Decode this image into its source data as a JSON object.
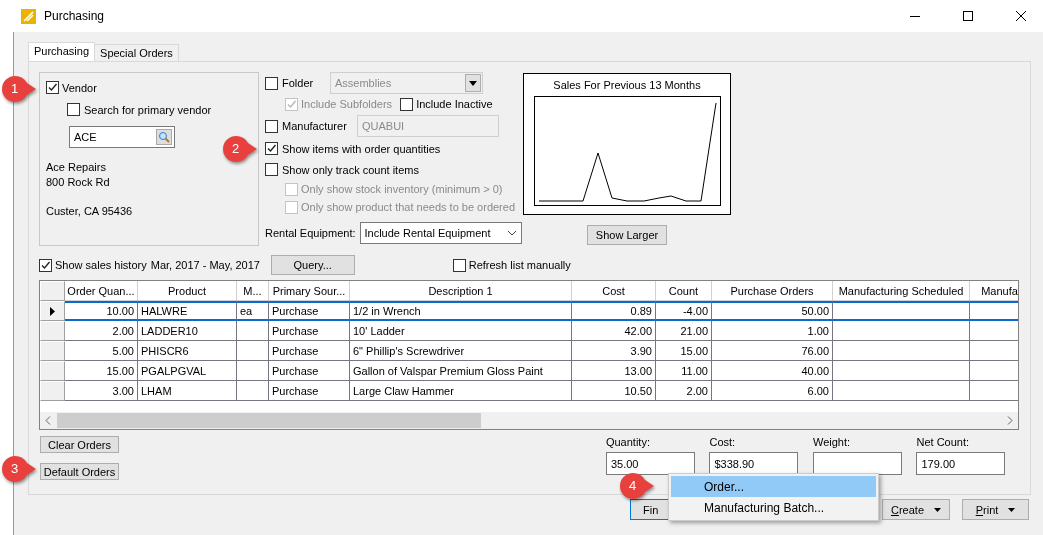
{
  "window": {
    "title": "Purchasing"
  },
  "tabs": [
    {
      "label": "Purchasing",
      "selected": true
    },
    {
      "label": "Special Orders",
      "selected": false
    }
  ],
  "vendor": {
    "label": "Vendor",
    "checked": true,
    "search_primary": {
      "label": "Search for primary vendor",
      "checked": false
    },
    "field_value": "ACE",
    "address": {
      "name": "Ace Repairs",
      "street": "800 Rock Rd",
      "city": "Custer, CA 95436"
    }
  },
  "folder": {
    "label": "Folder",
    "checked": false,
    "value": "Assemblies",
    "disabled": true
  },
  "include_subfolders": {
    "label": "Include Subfolders",
    "checked": true,
    "disabled": true
  },
  "include_inactive": {
    "label": "Include Inactive",
    "checked": false,
    "disabled": false
  },
  "manufacturer": {
    "label": "Manufacturer",
    "checked": false,
    "value": "QUABUI",
    "disabled": true
  },
  "options": [
    {
      "label": "Show items with order quantities",
      "checked": true,
      "disabled": false,
      "indent": false
    },
    {
      "label": "Show only track count items",
      "checked": false,
      "disabled": false,
      "indent": false
    },
    {
      "label": "Only show stock inventory (minimum > 0)",
      "checked": false,
      "disabled": true,
      "indent": true
    },
    {
      "label": "Only show product that needs to be ordered",
      "checked": false,
      "disabled": true,
      "indent": true
    }
  ],
  "rental": {
    "label": "Rental Equipment:",
    "value": "Include Rental Equipment"
  },
  "chart": {
    "title": "Sales For Previous 13 Months",
    "button": "Show Larger"
  },
  "sales_history": {
    "label": "Show sales history",
    "checked": true,
    "range": "Mar, 2017 - May, 2017"
  },
  "query_button": "Query...",
  "refresh": {
    "label": "Refresh list manually",
    "checked": false
  },
  "table": {
    "columns": [
      "Order Quan...",
      "Product",
      "M...",
      "Primary Sour...",
      "Description 1",
      "Cost",
      "Count",
      "Purchase Orders",
      "Manufacturing Scheduled",
      "Manufa"
    ],
    "rows": [
      {
        "selected": true,
        "cells": [
          "10.00",
          "HALWRE",
          "ea",
          "Purchase",
          "1/2 in Wrench",
          "0.89",
          "-4.00",
          "50.00"
        ]
      },
      {
        "selected": false,
        "cells": [
          "2.00",
          "LADDER10",
          "",
          "Purchase",
          "10' Ladder",
          "42.00",
          "21.00",
          "1.00"
        ]
      },
      {
        "selected": false,
        "cells": [
          "5.00",
          "PHISCR6",
          "",
          "Purchase",
          "6\" Phillip's Screwdriver",
          "3.90",
          "15.00",
          "76.00"
        ]
      },
      {
        "selected": false,
        "cells": [
          "15.00",
          "PGALPGVAL",
          "",
          "Purchase",
          "Gallon of Valspar Premium Gloss Paint",
          "13.00",
          "11.00",
          "40.00"
        ]
      },
      {
        "selected": false,
        "cells": [
          "3.00",
          "LHAM",
          "",
          "Purchase",
          "Large Claw Hammer",
          "10.50",
          "2.00",
          "6.00"
        ]
      }
    ]
  },
  "order_buttons": [
    "Clear Orders",
    "Default Orders"
  ],
  "totals": [
    {
      "label": "Quantity:",
      "value": "35.00"
    },
    {
      "label": "Cost:",
      "value": "$338.90"
    },
    {
      "label": "Weight:"
    },
    {
      "label": "Net Count:",
      "value": "179.00"
    }
  ],
  "footer_buttons": [
    {
      "label": "Fin",
      "kind": "plain"
    },
    {
      "label": "Create",
      "kind": "menu"
    },
    {
      "label": "Print",
      "kind": "menu"
    }
  ],
  "popup_menu": [
    {
      "label": "Order...",
      "selected": true
    },
    {
      "label": "Manufacturing Batch...",
      "selected": false
    }
  ],
  "callouts": [
    "1",
    "2",
    "3",
    "4"
  ]
}
